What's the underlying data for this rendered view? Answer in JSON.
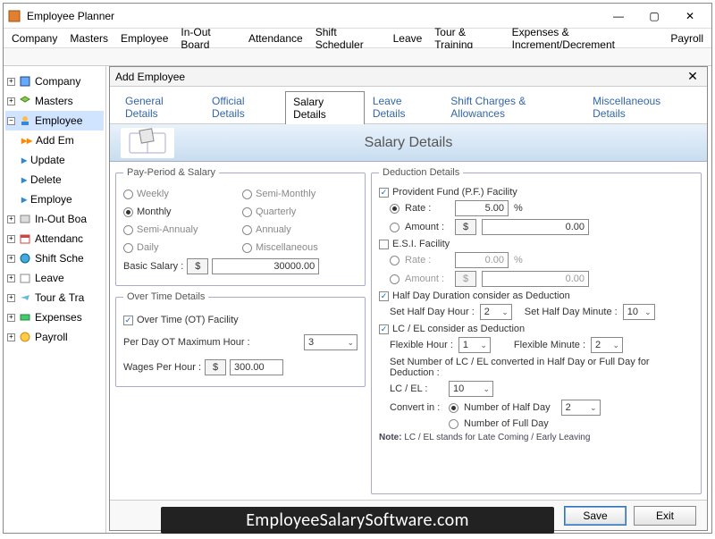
{
  "window": {
    "title": "Employee Planner"
  },
  "menubar": [
    "Company",
    "Masters",
    "Employee",
    "In-Out Board",
    "Attendance",
    "Shift Scheduler",
    "Leave",
    "Tour & Training",
    "Expenses & Increment/Decrement",
    "Payroll"
  ],
  "tree": {
    "items": [
      {
        "label": "Company",
        "icon": "building"
      },
      {
        "label": "Masters",
        "icon": "stack"
      },
      {
        "label": "Employee",
        "icon": "people",
        "expanded": true,
        "children": [
          {
            "label": "Add Em",
            "marker": "orange"
          },
          {
            "label": "Update",
            "marker": "blue"
          },
          {
            "label": "Delete",
            "marker": "blue"
          },
          {
            "label": "Employe",
            "marker": "blue"
          }
        ]
      },
      {
        "label": "In-Out Boa",
        "icon": "board"
      },
      {
        "label": "Attendanc",
        "icon": "calendar"
      },
      {
        "label": "Shift Sche",
        "icon": "clock"
      },
      {
        "label": "Leave",
        "icon": "cal2"
      },
      {
        "label": "Tour & Tra",
        "icon": "plane"
      },
      {
        "label": "Expenses",
        "icon": "money"
      },
      {
        "label": "Payroll",
        "icon": "coin"
      }
    ]
  },
  "dialog": {
    "title": "Add Employee",
    "tabs": [
      "General Details",
      "Official Details",
      "Salary Details",
      "Leave Details",
      "Shift Charges & Allowances",
      "Miscellaneous Details"
    ],
    "active_tab": "Salary Details",
    "banner_title": "Salary Details"
  },
  "pay_period": {
    "legend": "Pay-Period & Salary",
    "options": {
      "weekly": "Weekly",
      "semi_monthly": "Semi-Monthly",
      "monthly": "Monthly",
      "quarterly": "Quarterly",
      "semi_annual": "Semi-Annualy",
      "annual": "Annualy",
      "daily": "Daily",
      "misc": "Miscellaneous"
    },
    "selected": "monthly",
    "basic_salary_label": "Basic Salary :",
    "currency": "$",
    "basic_salary": "30000.00"
  },
  "overtime": {
    "legend": "Over Time Details",
    "facility_label": "Over Time (OT) Facility",
    "facility_checked": true,
    "per_day_label": "Per Day OT Maximum Hour :",
    "per_day_value": "3",
    "wages_label": "Wages Per Hour :",
    "currency": "$",
    "wages_value": "300.00"
  },
  "deduction": {
    "legend": "Deduction Details",
    "pf_label": "Provident Fund (P.F.) Facility",
    "pf_checked": true,
    "pf_rate_label": "Rate :",
    "pf_rate_value": "5.00",
    "pf_amount_label": "Amount :",
    "pf_amount_value": "0.00",
    "pf_currency": "$",
    "esi_label": "E.S.I. Facility",
    "esi_checked": false,
    "esi_rate_label": "Rate :",
    "esi_rate_value": "0.00",
    "esi_amount_label": "Amount :",
    "esi_amount_value": "0.00",
    "esi_currency": "$",
    "halfday_label": "Half Day Duration consider as Deduction",
    "halfday_checked": true,
    "halfday_hour_label": "Set Half Day Hour :",
    "halfday_hour": "2",
    "halfday_min_label": "Set Half Day Minute :",
    "halfday_min": "10",
    "lcel_label": "LC / EL consider as Deduction",
    "lcel_checked": true,
    "flex_hour_label": "Flexible Hour :",
    "flex_hour": "1",
    "flex_min_label": "Flexible Minute :",
    "flex_min": "2",
    "lcel_desc": "Set Number of LC / EL converted in Half Day or Full Day for Deduction :",
    "lcel_count_label": "LC / EL :",
    "lcel_count": "10",
    "convert_label": "Convert in :",
    "convert_half": "Number of Half Day",
    "convert_half_val": "2",
    "convert_full": "Number of Full Day",
    "note_label": "Note:",
    "note_text": "LC / EL stands for Late Coming / Early Leaving",
    "percent": "%"
  },
  "buttons": {
    "save": "Save",
    "exit": "Exit"
  },
  "watermark": "EmployeeSalarySoftware.com"
}
